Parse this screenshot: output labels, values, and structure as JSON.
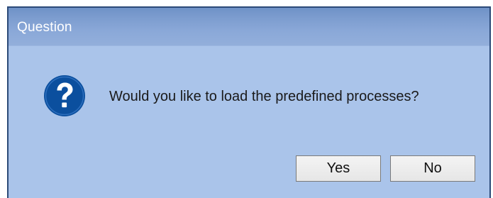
{
  "dialog": {
    "title": "Question",
    "message": "Would you like to load the predefined processes?",
    "icon": "question-icon",
    "buttons": {
      "yes_label": "Yes",
      "no_label": "No"
    }
  },
  "colors": {
    "dialog_background": "#aac4ea",
    "titlebar": "#7e9ed0",
    "border": "#2c4a78",
    "icon_background": "#0b4f9e"
  }
}
